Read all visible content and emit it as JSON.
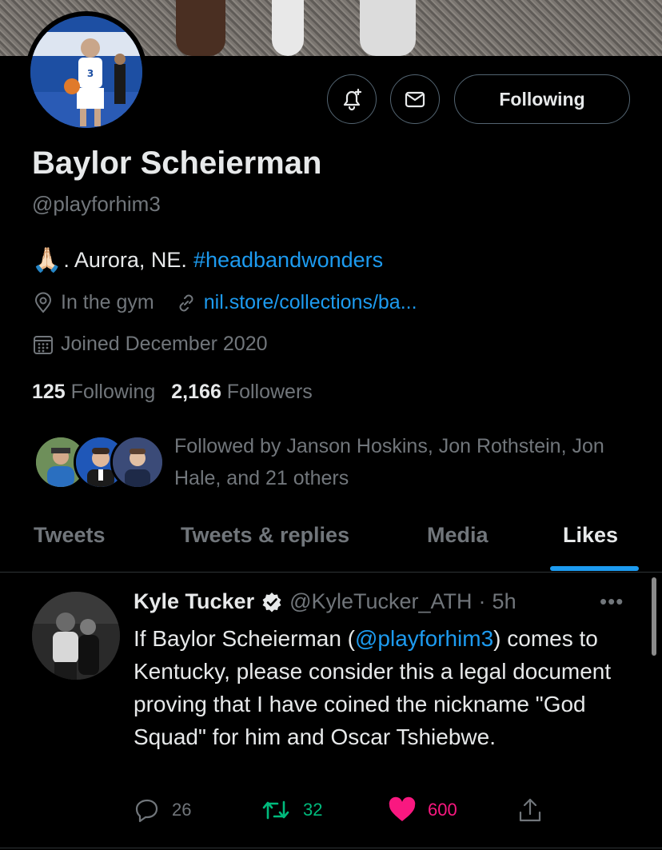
{
  "profile": {
    "name": "Baylor Scheierman",
    "handle": "@playforhim3",
    "bio_emoji": "🙏🏻",
    "bio_text": ". Aurora, NE.",
    "bio_hashtag": "#headbandwonders",
    "location": "In the gym",
    "website": "nil.store/collections/ba...",
    "joined": "Joined December 2020",
    "following_count": "125",
    "following_label": "Following",
    "followers_count": "2,166",
    "followers_label": "Followers",
    "followed_by": "Followed by Janson Hoskins, Jon Rothstein, Jon Hale, and 21 others"
  },
  "actions": {
    "follow_label": "Following"
  },
  "tabs": [
    {
      "label": "Tweets"
    },
    {
      "label": "Tweets & replies"
    },
    {
      "label": "Media"
    },
    {
      "label": "Likes"
    }
  ],
  "tweet": {
    "author": "Kyle Tucker",
    "handle": "@KyleTucker_ATH",
    "dot": "·",
    "time": "5h",
    "more": "•••",
    "text_before": "If Baylor Scheierman (",
    "mention": "@playforhim3",
    "text_after": ") comes to Kentucky, please consider this a legal document proving that I have coined the nickname \"God Squad\" for him and Oscar Tshiebwe.",
    "replies": "26",
    "retweets": "32",
    "likes": "600"
  },
  "colors": {
    "accent": "#1d9bf0",
    "retweet": "#00ba7c",
    "like": "#f91880",
    "muted": "#71767b"
  }
}
